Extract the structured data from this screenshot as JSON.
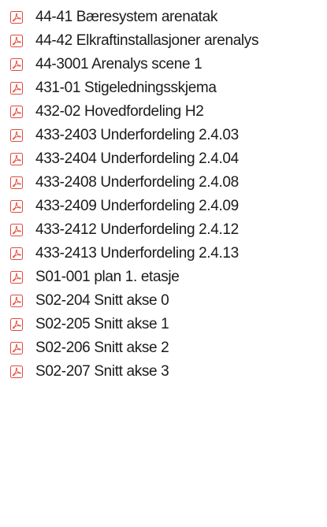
{
  "icon": "pdf-file-icon",
  "accent_color": "#e2493d",
  "files": [
    {
      "name": "44-41 Bæresystem arenatak"
    },
    {
      "name": "44-42 Elkraftinstallasjoner arenalys"
    },
    {
      "name": "44-3001 Arenalys scene 1"
    },
    {
      "name": "431-01 Stigeledningsskjema"
    },
    {
      "name": "432-02 Hovedfordeling H2"
    },
    {
      "name": "433-2403 Underfordeling 2.4.03"
    },
    {
      "name": "433-2404 Underfordeling 2.4.04"
    },
    {
      "name": "433-2408 Underfordeling 2.4.08"
    },
    {
      "name": "433-2409 Underfordeling 2.4.09"
    },
    {
      "name": "433-2412 Underfordeling 2.4.12"
    },
    {
      "name": "433-2413 Underfordeling 2.4.13"
    },
    {
      "name": "S01-001 plan 1. etasje"
    },
    {
      "name": "S02-204 Snitt akse 0"
    },
    {
      "name": "S02-205 Snitt akse 1"
    },
    {
      "name": "S02-206 Snitt akse 2"
    },
    {
      "name": "S02-207 Snitt akse 3"
    }
  ]
}
